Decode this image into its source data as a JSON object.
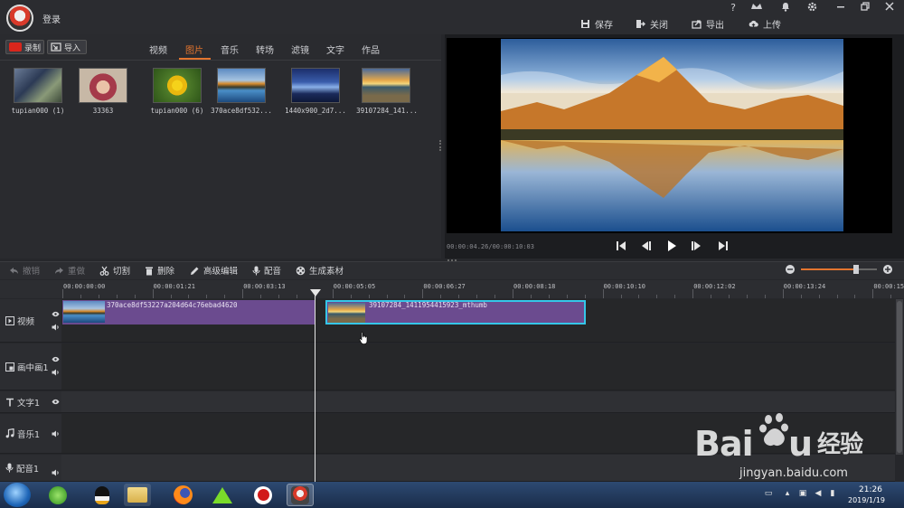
{
  "header": {
    "login": "登录",
    "window_controls": [
      "?",
      "VIP",
      "bell",
      "gear",
      "minimize",
      "restore",
      "close"
    ],
    "actions": [
      {
        "label": "保存",
        "icon": "save-icon"
      },
      {
        "label": "关闭",
        "icon": "exit-icon"
      },
      {
        "label": "导出",
        "icon": "export-icon"
      },
      {
        "label": "上传",
        "icon": "upload-icon"
      }
    ]
  },
  "media": {
    "record_label": "录制",
    "import_label": "导入",
    "tabs": [
      "视频",
      "图片",
      "音乐",
      "转场",
      "滤镜",
      "文字",
      "作品"
    ],
    "active_tab": "图片",
    "items": [
      {
        "name": "tupian000 (1)"
      },
      {
        "name": "33363"
      },
      {
        "name": "tupian000 (6)"
      },
      {
        "name": "370ace8df532..."
      },
      {
        "name": "1440x900_2d7..."
      },
      {
        "name": "39107284_141..."
      }
    ]
  },
  "preview": {
    "timecode": "00:00:04.26/00:00:10:03"
  },
  "toolbar": {
    "undo": "撤销",
    "redo": "重做",
    "cut": "切割",
    "delete": "删除",
    "advanced_edit": "高级编辑",
    "dub": "配音",
    "generate": "生成素材",
    "zoom_level": 0.72
  },
  "ruler": {
    "ticks": [
      "00:00:00:00",
      "00:00:01:21",
      "00:00:03:13",
      "00:00:05:05",
      "00:00:06:27",
      "00:00:08:18",
      "00:00:10:10",
      "00:00:12:02",
      "00:00:13:24",
      "00:00:15:"
    ]
  },
  "tracks": [
    {
      "label": "视频",
      "icon": "play-icon"
    },
    {
      "label": "画中画1",
      "icon": "pip-icon"
    },
    {
      "label": "文字1",
      "icon": "text-icon"
    },
    {
      "label": "音乐1",
      "icon": "music-icon"
    },
    {
      "label": "配音1",
      "icon": "mic-icon"
    }
  ],
  "clips": [
    {
      "name": "370ace8df53227a204d64c76ebad4620"
    },
    {
      "name": "39107284_1411954415923_mthumb"
    }
  ],
  "taskbar": {
    "time": "21:26",
    "date": "2019/1/19"
  },
  "watermark": {
    "logo": "Baidu经验",
    "url": "jingyan.baidu.com"
  },
  "colors": {
    "accent": "#e3752f",
    "clip": "#6b4b8f",
    "clip_selected_border": "#35c6e8",
    "record_red": "#d9261c"
  }
}
